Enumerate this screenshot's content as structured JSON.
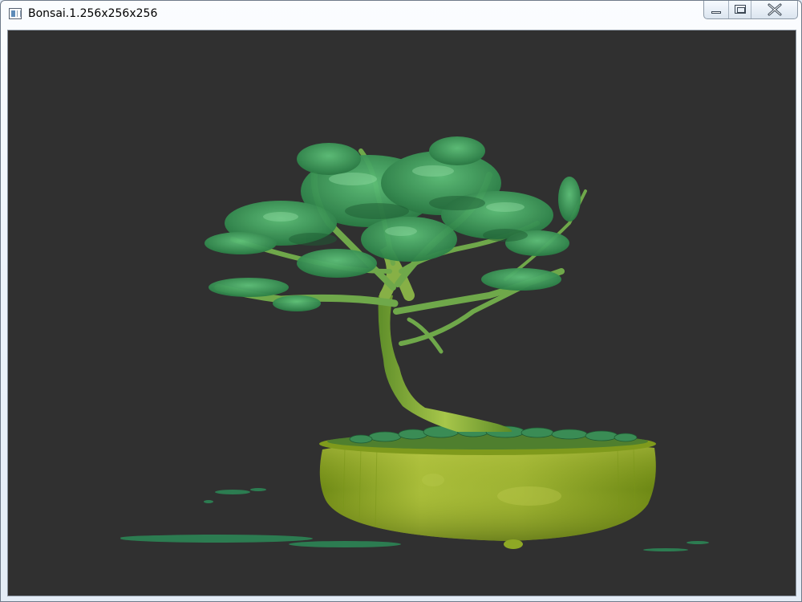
{
  "window": {
    "title": "Bonsai.1.256x256x256",
    "icon": "app-window-icon"
  },
  "caption_buttons": {
    "minimize": "minimize-icon",
    "maximize": "maximize-icon",
    "close": "close-icon"
  },
  "viewport": {
    "background": "#303030",
    "render": "volume-rendered bonsai tree in pot",
    "colors": {
      "foliage": "#2f8f4e",
      "foliage_light": "#5fc27a",
      "trunk": "#8fb83f",
      "pot": "#8aa61f",
      "pot_light": "#b5c84a"
    }
  }
}
